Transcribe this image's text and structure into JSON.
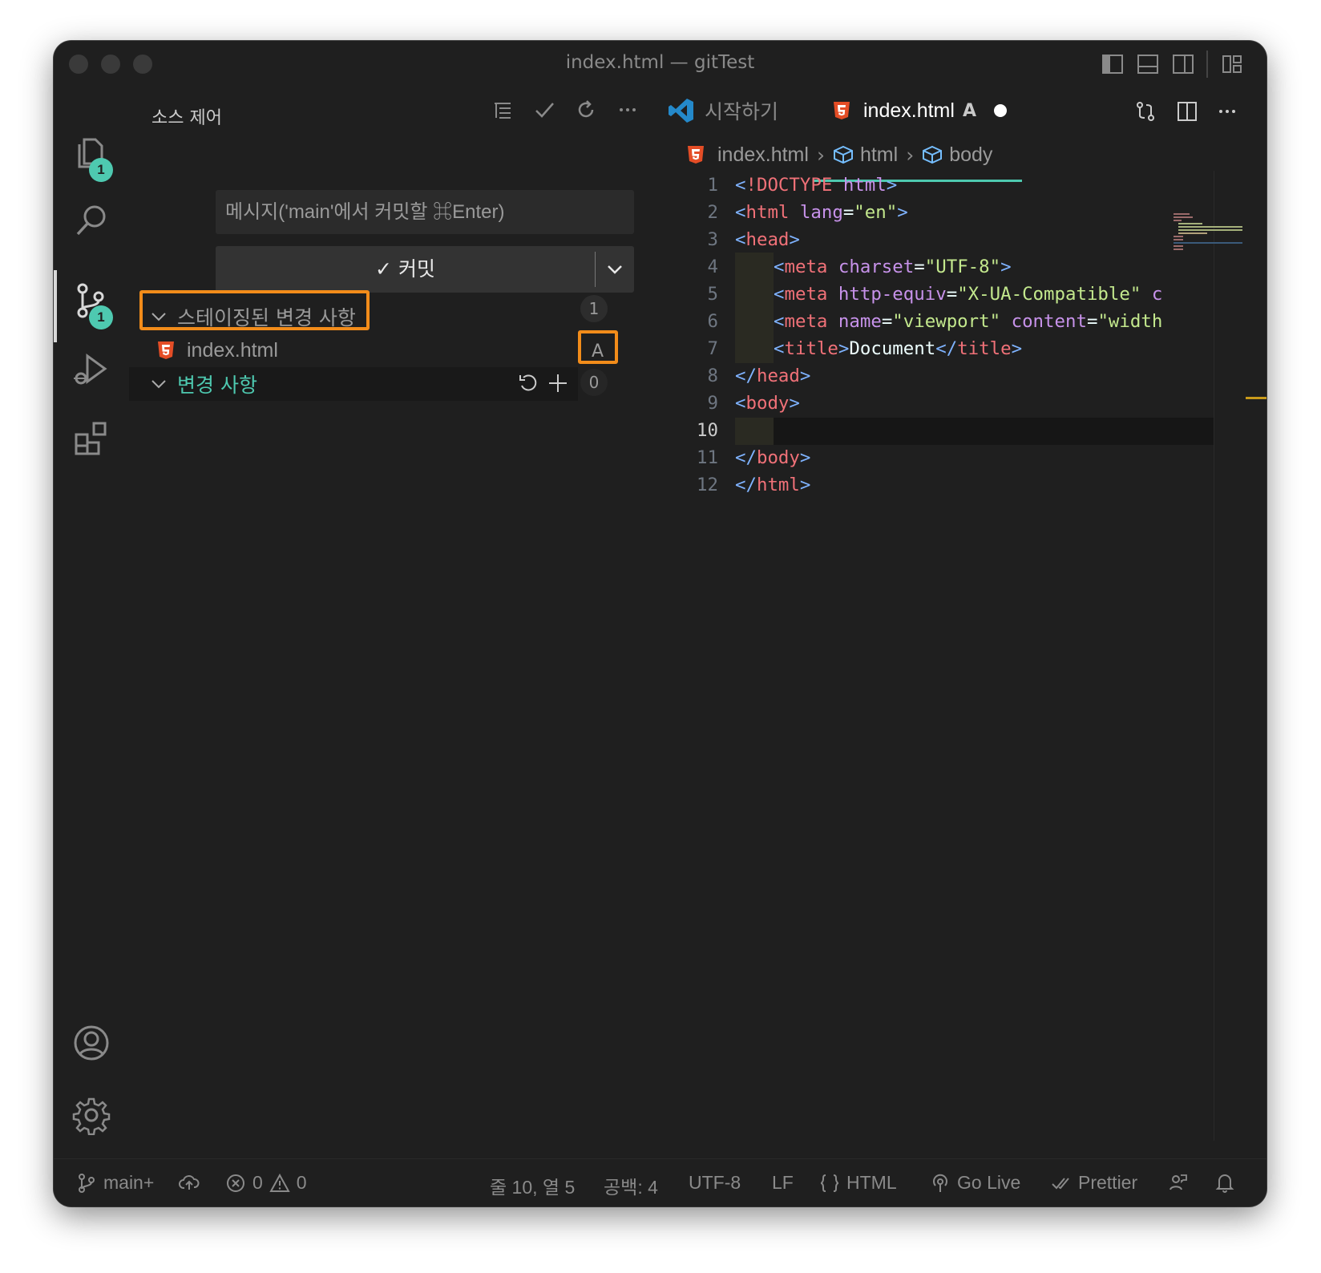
{
  "window": {
    "title": "index.html — gitTest"
  },
  "activity_bar": {
    "explorer_badge": "1",
    "scm_badge": "1"
  },
  "sidebar": {
    "title": "소스 제어",
    "commit_placeholder": "메시지('main'에서 커밋할 ⌘Enter)",
    "commit_label": "✓ 커밋",
    "staged_group": {
      "label": "스테이징된 변경 사항",
      "count": "1"
    },
    "staged_files": [
      {
        "name": "index.html",
        "status": "A"
      }
    ],
    "changes_group": {
      "label": "변경 사항",
      "count": "0"
    }
  },
  "tabs": [
    {
      "label": "시작하기",
      "active": false
    },
    {
      "label": "index.html",
      "status": "A",
      "active": true,
      "dirty": true
    }
  ],
  "breadcrumb": [
    "index.html",
    "html",
    "body"
  ],
  "code": {
    "current_line": "10",
    "lines": [
      {
        "n": "1"
      },
      {
        "n": "2"
      },
      {
        "n": "3"
      },
      {
        "n": "4"
      },
      {
        "n": "5"
      },
      {
        "n": "6"
      },
      {
        "n": "7"
      },
      {
        "n": "8"
      },
      {
        "n": "9"
      },
      {
        "n": "10"
      },
      {
        "n": "11"
      },
      {
        "n": "12"
      }
    ]
  },
  "statusbar": {
    "branch": "main+",
    "errors": "0",
    "warnings": "0",
    "position": "줄 10, 열 5",
    "spaces": "공백: 4",
    "encoding": "UTF-8",
    "eol": "LF",
    "language": "HTML",
    "golive": "Go Live",
    "prettier": "Prettier"
  },
  "colors": {
    "accent": "#4ec9b0",
    "highlight": "#f28c1a",
    "html_icon": "#e44d26",
    "vscode_blue": "#2489ca"
  }
}
